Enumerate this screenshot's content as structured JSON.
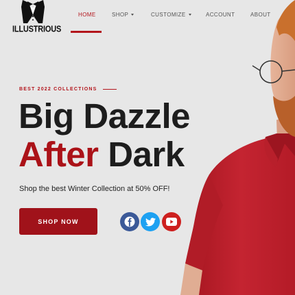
{
  "brand": {
    "name": "ILLUSTRIOUS"
  },
  "nav": {
    "items": [
      {
        "label": "HOME",
        "active": true,
        "dropdown": false
      },
      {
        "label": "SHOP",
        "active": false,
        "dropdown": true
      },
      {
        "label": "CUSTOMIZE",
        "active": false,
        "dropdown": true
      },
      {
        "label": "ACCOUNT",
        "active": false,
        "dropdown": false
      },
      {
        "label": "ABOUT",
        "active": false,
        "dropdown": false
      }
    ]
  },
  "hero": {
    "eyebrow": "BEST 2022 COLLECTIONS",
    "headline_line1": "Big Dazzle",
    "headline_accent": "After",
    "headline_rest": "Dark",
    "subtext": "Shop the best Winter Collection at 50% OFF!",
    "cta_label": "SHOP NOW"
  },
  "social": {
    "items": [
      {
        "icon": "facebook-icon",
        "color": "#3b5998"
      },
      {
        "icon": "twitter-icon",
        "color": "#1da1f2"
      },
      {
        "icon": "youtube-icon",
        "color": "#cd201f"
      }
    ]
  },
  "colors": {
    "accent": "#b3141b",
    "cta_background": "#a0121a",
    "text_dark": "#1d1d1d",
    "background": "#e7e7e7"
  }
}
